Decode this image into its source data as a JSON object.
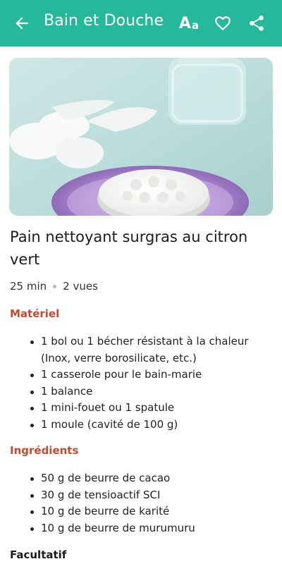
{
  "appbar": {
    "title": "Bain et Douche",
    "back_icon": "arrow-left-icon",
    "font_size_big": "A",
    "font_size_small": "a",
    "favorite_icon": "heart-outline-icon",
    "share_icon": "share-icon",
    "color": "#25b89a"
  },
  "recipe": {
    "title": "Pain nettoyant surgras au citron vert",
    "duration": "25 min",
    "views": "2 vues"
  },
  "materiel": {
    "heading": "Matériel",
    "items": [
      "1 bol ou 1 bécher résistant à la chaleur (Inox, verre borosilicate, etc.)",
      "1 casserole pour le bain-marie",
      "1 balance",
      "1 mini-fouet ou 1 spatule",
      "1 moule (cavité de 100 g)"
    ]
  },
  "ingredients": {
    "heading": "Ingrédients",
    "items": [
      "50 g de beurre de cacao",
      "30 g de tensioactif SCI",
      "10 g de beurre de karité",
      "10 g de beurre de murumuru"
    ]
  },
  "facultatif": {
    "heading": "Facultatif"
  },
  "colors": {
    "accent": "#25b89a",
    "section_heading": "#c64a2f"
  }
}
